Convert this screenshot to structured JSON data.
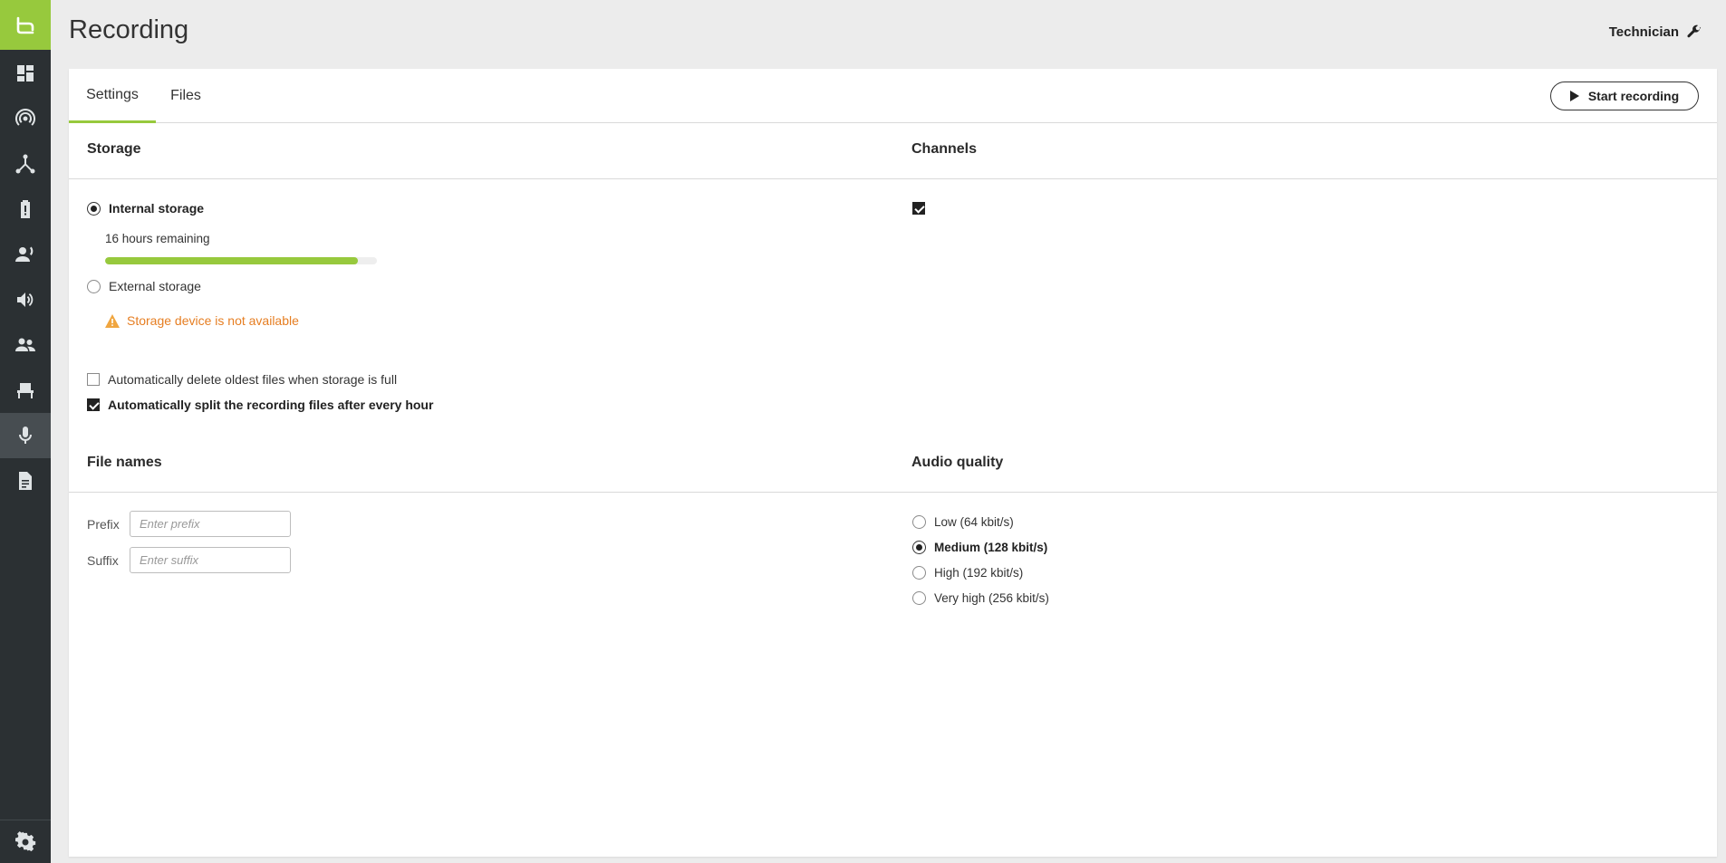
{
  "page": {
    "title": "Recording"
  },
  "header": {
    "user_role": "Technician",
    "user_icon": "wrench-icon"
  },
  "sidebar": {
    "logo_icon": "brand-logo-icon",
    "items": [
      {
        "name": "dashboard",
        "icon": "dashboard-icon"
      },
      {
        "name": "broadcast",
        "icon": "broadcast-icon"
      },
      {
        "name": "network",
        "icon": "network-icon"
      },
      {
        "name": "battery",
        "icon": "battery-icon"
      },
      {
        "name": "speaker-person",
        "icon": "person-speaking-icon"
      },
      {
        "name": "audio",
        "icon": "speaker-icon"
      },
      {
        "name": "participants",
        "icon": "people-icon"
      },
      {
        "name": "seats",
        "icon": "seat-icon"
      },
      {
        "name": "recording",
        "icon": "microphone-icon",
        "active": true
      },
      {
        "name": "files",
        "icon": "document-icon"
      }
    ],
    "settings_icon": "gear-icon"
  },
  "tabs": [
    {
      "label": "Settings",
      "active": true
    },
    {
      "label": "Files",
      "active": false
    }
  ],
  "actions": {
    "start_recording": "Start recording"
  },
  "storage": {
    "title": "Storage",
    "internal": {
      "label": "Internal storage",
      "selected": true,
      "remaining": "16 hours remaining",
      "fill_percent": 93
    },
    "external": {
      "label": "External storage",
      "selected": false,
      "warning": "Storage device is not available"
    },
    "options": [
      {
        "label": "Automatically delete oldest files when storage is full",
        "checked": false
      },
      {
        "label": "Automatically split the recording files after every hour",
        "checked": true
      }
    ]
  },
  "channels": {
    "title": "Channels",
    "items": [
      {
        "label": "",
        "checked": true
      }
    ]
  },
  "file_names": {
    "title": "File names",
    "prefix": {
      "label": "Prefix",
      "value": "",
      "placeholder": "Enter prefix"
    },
    "suffix": {
      "label": "Suffix",
      "value": "",
      "placeholder": "Enter suffix"
    }
  },
  "audio_quality": {
    "title": "Audio quality",
    "options": [
      {
        "label": "Low (64 kbit/s)",
        "selected": false
      },
      {
        "label": "Medium (128 kbit/s)",
        "selected": true
      },
      {
        "label": "High (192 kbit/s)",
        "selected": false
      },
      {
        "label": "Very high (256 kbit/s)",
        "selected": false
      }
    ]
  },
  "colors": {
    "accent": "#97c93d",
    "sidebar": "#2b3033",
    "warning": "#e67e22"
  }
}
